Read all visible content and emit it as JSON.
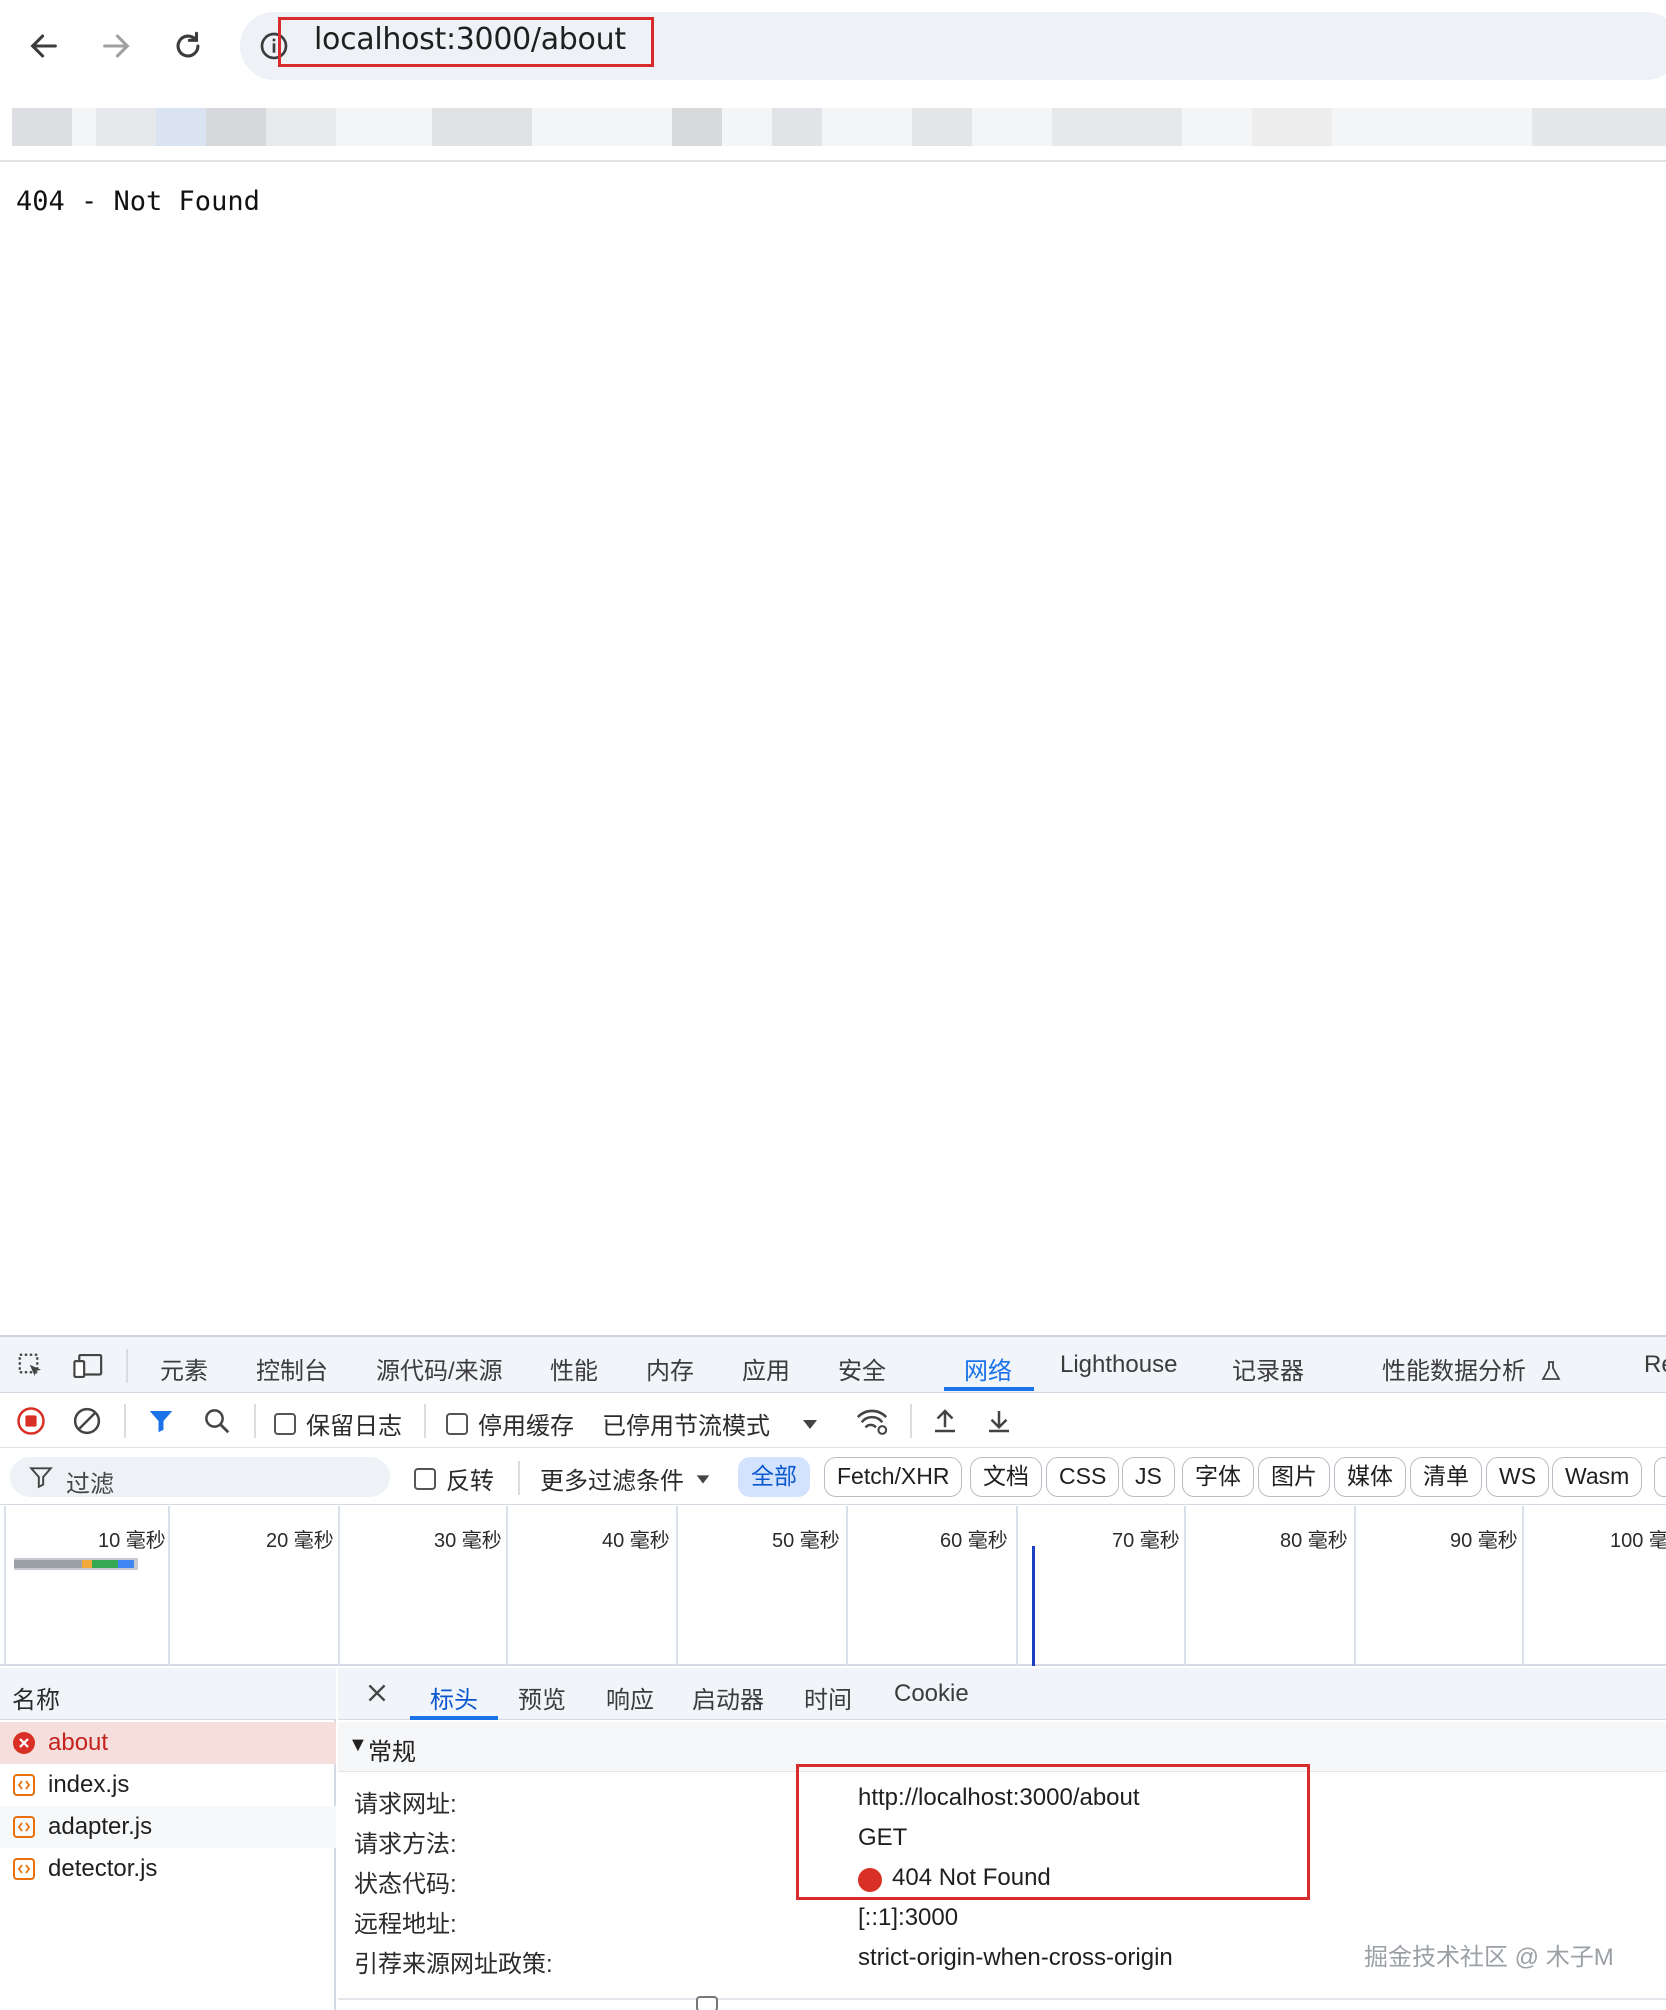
{
  "browser": {
    "url": "localhost:3000/about"
  },
  "page": {
    "message": "404 - Not Found"
  },
  "devtools": {
    "tabs": [
      "元素",
      "控制台",
      "源代码/来源",
      "性能",
      "内存",
      "应用",
      "安全",
      "网络",
      "Lighthouse",
      "记录器",
      "性能数据分析",
      "Re"
    ],
    "active_tab": "网络",
    "toolbar": {
      "preserve_log": "保留日志",
      "disable_cache": "停用缓存",
      "throttling": "已停用节流模式"
    },
    "filter": {
      "placeholder": "过滤",
      "invert": "反转",
      "more_filters": "更多过滤条件",
      "types": [
        "全部",
        "Fetch/XHR",
        "文档",
        "CSS",
        "JS",
        "字体",
        "图片",
        "媒体",
        "清单",
        "WS",
        "Wasm"
      ],
      "active_type": "全部"
    },
    "timeline": {
      "ticks": [
        "10 毫秒",
        "20 毫秒",
        "30 毫秒",
        "40 毫秒",
        "50 毫秒",
        "60 毫秒",
        "70 毫秒",
        "80 毫秒",
        "90 毫秒",
        "100 毫"
      ]
    },
    "requests": {
      "header": "名称",
      "items": [
        {
          "name": "about",
          "status": "error"
        },
        {
          "name": "index.js",
          "status": "ok"
        },
        {
          "name": "adapter.js",
          "status": "ok"
        },
        {
          "name": "detector.js",
          "status": "ok"
        }
      ]
    },
    "detail": {
      "tabs": [
        "标头",
        "预览",
        "响应",
        "启动器",
        "时间",
        "Cookie"
      ],
      "active_tab": "标头",
      "section": "常规",
      "rows": [
        {
          "key": "请求网址:",
          "value": "http://localhost:3000/about"
        },
        {
          "key": "请求方法:",
          "value": "GET"
        },
        {
          "key": "状态代码:",
          "value": "404 Not Found"
        },
        {
          "key": "远程地址:",
          "value": "[::1]:3000"
        },
        {
          "key": "引荐来源网址政策:",
          "value": "strict-origin-when-cross-origin"
        }
      ]
    }
  },
  "watermark": "掘金技术社区 @ 木子M",
  "colors": {
    "highlight": "#d92b2b",
    "accent": "#1a73e8",
    "error": "#d93025"
  }
}
